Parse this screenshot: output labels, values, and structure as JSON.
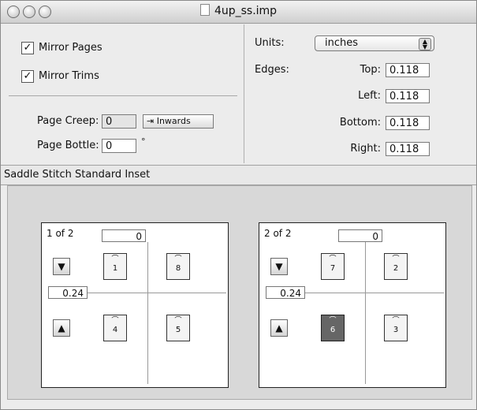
{
  "window": {
    "title": "4up_ss.imp"
  },
  "left_panel": {
    "mirror_pages": {
      "label": "Mirror Pages",
      "checked": true
    },
    "mirror_trims": {
      "label": "Mirror Trims",
      "checked": true
    },
    "page_creep": {
      "label": "Page Creep:",
      "value": "0",
      "button": "Inwards"
    },
    "page_bottle": {
      "label": "Page Bottle:",
      "value": "0",
      "unit": "°"
    }
  },
  "right_panel": {
    "units": {
      "label": "Units:",
      "value": "inches"
    },
    "edges": {
      "label": "Edges:",
      "top": {
        "label": "Top:",
        "value": "0.118"
      },
      "left": {
        "label": "Left:",
        "value": "0.118"
      },
      "bottom": {
        "label": "Bottom:",
        "value": "0.118"
      },
      "right": {
        "label": "Right:",
        "value": "0.118"
      }
    }
  },
  "section": {
    "title": "Saddle Stitch Standard Inset"
  },
  "sheets": [
    {
      "label": "1 of 2",
      "top_value": "0",
      "gutter_value": "0.24",
      "pages": [
        {
          "num": "1",
          "dark": false
        },
        {
          "num": "8",
          "dark": false
        },
        {
          "num": "4",
          "dark": false
        },
        {
          "num": "5",
          "dark": false
        }
      ]
    },
    {
      "label": "2 of 2",
      "top_value": "0",
      "gutter_value": "0.24",
      "pages": [
        {
          "num": "7",
          "dark": false
        },
        {
          "num": "2",
          "dark": false
        },
        {
          "num": "6",
          "dark": true
        },
        {
          "num": "3",
          "dark": false
        }
      ]
    }
  ],
  "icons": {
    "down": "down-arrow-icon",
    "up": "up-arrow-icon"
  }
}
